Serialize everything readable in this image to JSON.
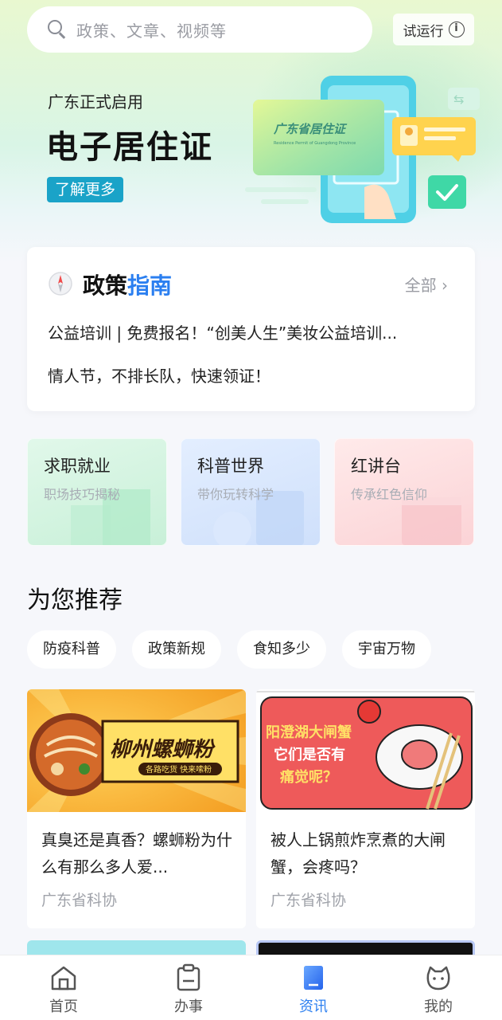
{
  "search": {
    "placeholder": "政策、文章、视频等"
  },
  "trial_badge": {
    "label": "试运行"
  },
  "banner": {
    "subtitle": "广东正式启用",
    "title": "电子居住证",
    "button": "了解更多",
    "card_text": "广东省居住证",
    "card_subtext": "Residence Permit of Guangdong Province"
  },
  "policy_guide": {
    "title_part1": "政策",
    "title_part2": "指南",
    "all_label": "全部",
    "items": [
      "公益培训 | 免费报名！“创美人生”美妆公益培训...",
      "情人节，不排长队，快速领证！"
    ]
  },
  "categories": [
    {
      "title": "求职就业",
      "subtitle": "职场技巧揭秘"
    },
    {
      "title": "科普世界",
      "subtitle": "带你玩转科学"
    },
    {
      "title": "红讲台",
      "subtitle": "传承红色信仰"
    }
  ],
  "recommend": {
    "title": "为您推荐",
    "chips": [
      "防疫科普",
      "政策新规",
      "食知多少",
      "宇宙万物"
    ]
  },
  "articles": [
    {
      "thumb_title": "柳州螺蛳粉",
      "thumb_sub": "各路吃货 快来嗦粉",
      "title": "真臭还是真香？螺蛳粉为什么有那么多人爱...",
      "source": "广东省科协"
    },
    {
      "thumb_lines": [
        "阳澄湖大闸蟹",
        "它们是否有",
        "痛觉呢？"
      ],
      "title": "被人上锅煎炸烹煮的大闸蟹，会疼吗？",
      "source": "广东省科协"
    }
  ],
  "tabbar": {
    "items": [
      {
        "label": "首页",
        "icon": "home-icon"
      },
      {
        "label": "办事",
        "icon": "clipboard-icon"
      },
      {
        "label": "资讯",
        "icon": "news-icon",
        "active": true
      },
      {
        "label": "我的",
        "icon": "profile-icon"
      }
    ]
  },
  "colors": {
    "accent": "#2b7ff0",
    "learn_more_bg": "#1aa3c8"
  }
}
